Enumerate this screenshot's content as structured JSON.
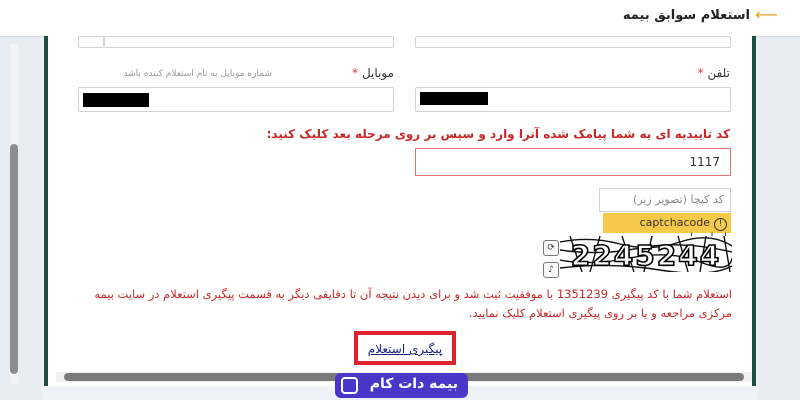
{
  "header": {
    "title": "استعلام سوابق بیمه",
    "back_icon": "arrow-left-icon",
    "accent": "#e8a21b"
  },
  "form": {
    "phone_label": "تلفن",
    "mobile_label": "موبایل",
    "required_mark": "*",
    "mobile_hint": "شماره موبایل به نام استعلام کننده باشد",
    "sms_instruction": "کد تاییدیه ای به شما پیامک شده آنرا وارد و سپس بر روی مرحله بعد کلیک کنید:",
    "sms_code_value": "1117",
    "captcha_placeholder": "کد کپچا (تصویر زیر)",
    "captcha_required": "captchacode اجباری است",
    "captcha_text": "2245244"
  },
  "result": {
    "message": "استعلام شما با کد پیگیری 1351239 با موفقیت ثبت شد و برای دیدن نتیجه آن تا دقایقی دیگر به قسمت پیگیری استعلام در سایت بیمه مرکزی مراجعه و یا بر روی پیگیری استعلام کلیک نمایید.",
    "followup_label": "پیگیری استعلام"
  },
  "brand": {
    "logo_text": "بیمه دات کام",
    "color": "#4a36c8"
  }
}
